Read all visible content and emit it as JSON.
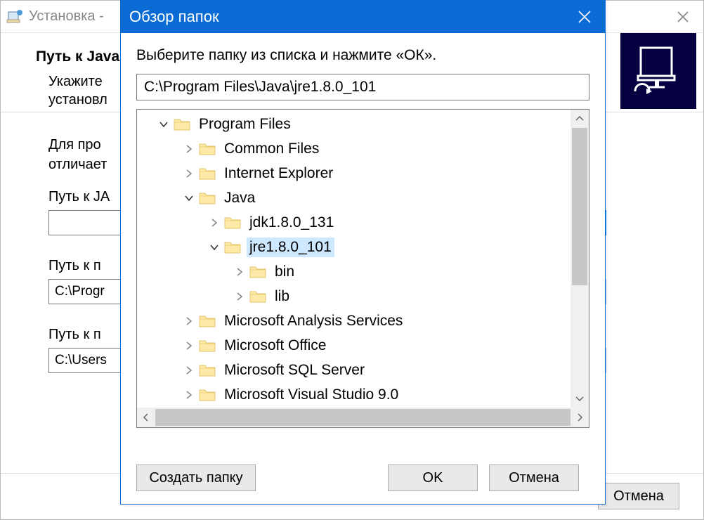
{
  "parent": {
    "title": "Установка -",
    "heading": "Путь к Java",
    "sub1": "Укажите",
    "sub2": "установл",
    "para1": "Для про",
    "para2": "отличает",
    "field1_label": "Путь к JA",
    "field1_value": "",
    "field2_label": "Путь к п",
    "field2_value": "C:\\Progr",
    "field3_label": "Путь к п",
    "field3_value": "C:\\Users",
    "browse": "..",
    "cancel": "Отмена"
  },
  "dialog": {
    "title": "Обзор папок",
    "prompt": "Выберите папку из списка и нажмите «ОК».",
    "path": "C:\\Program Files\\Java\\jre1.8.0_101",
    "new_folder": "Создать папку",
    "ok": "OK",
    "cancel": "Отмена"
  },
  "tree": [
    {
      "indent": 0,
      "chev": "down",
      "label": "Program Files",
      "selected": false
    },
    {
      "indent": 1,
      "chev": "right",
      "label": "Common Files",
      "selected": false
    },
    {
      "indent": 1,
      "chev": "right",
      "label": "Internet Explorer",
      "selected": false
    },
    {
      "indent": 1,
      "chev": "down",
      "label": "Java",
      "selected": false
    },
    {
      "indent": 2,
      "chev": "right",
      "label": "jdk1.8.0_131",
      "selected": false
    },
    {
      "indent": 2,
      "chev": "down",
      "label": "jre1.8.0_101",
      "selected": true
    },
    {
      "indent": 3,
      "chev": "right",
      "label": "bin",
      "selected": false
    },
    {
      "indent": 3,
      "chev": "right",
      "label": "lib",
      "selected": false
    },
    {
      "indent": 1,
      "chev": "right",
      "label": "Microsoft Analysis Services",
      "selected": false
    },
    {
      "indent": 1,
      "chev": "right",
      "label": "Microsoft Office",
      "selected": false
    },
    {
      "indent": 1,
      "chev": "right",
      "label": "Microsoft SQL Server",
      "selected": false
    },
    {
      "indent": 1,
      "chev": "right",
      "label": "Microsoft Visual Studio 9.0",
      "selected": false
    }
  ]
}
